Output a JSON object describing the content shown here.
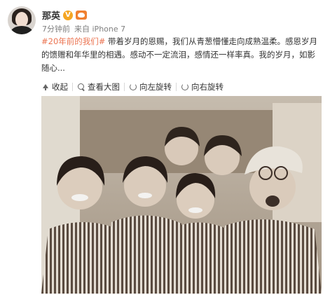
{
  "post": {
    "username": "那英",
    "verified_icon": "verified-v-icon",
    "vip_icon": "vip-crown-icon",
    "time": "7分钟前",
    "source_prefix": "来自",
    "source_device": "iPhone 7",
    "hashtag": "#20年前的我们#",
    "body": " 带着岁月的恩赐，我们从青葱懵懂走向成熟温柔。感恩岁月的馈赠和年华里的相遇。感动不一定流泪，感情还一样率真。我的岁月，如影随心..."
  },
  "toolbar": {
    "collapse_label": "收起",
    "view_large_label": "查看大图",
    "rotate_left_label": "向左旋转",
    "rotate_right_label": "向右旋转"
  },
  "colors": {
    "hashtag": "#eb7350",
    "sepia_dark": "#4a3b32",
    "sepia_light": "#e9e2d8"
  }
}
